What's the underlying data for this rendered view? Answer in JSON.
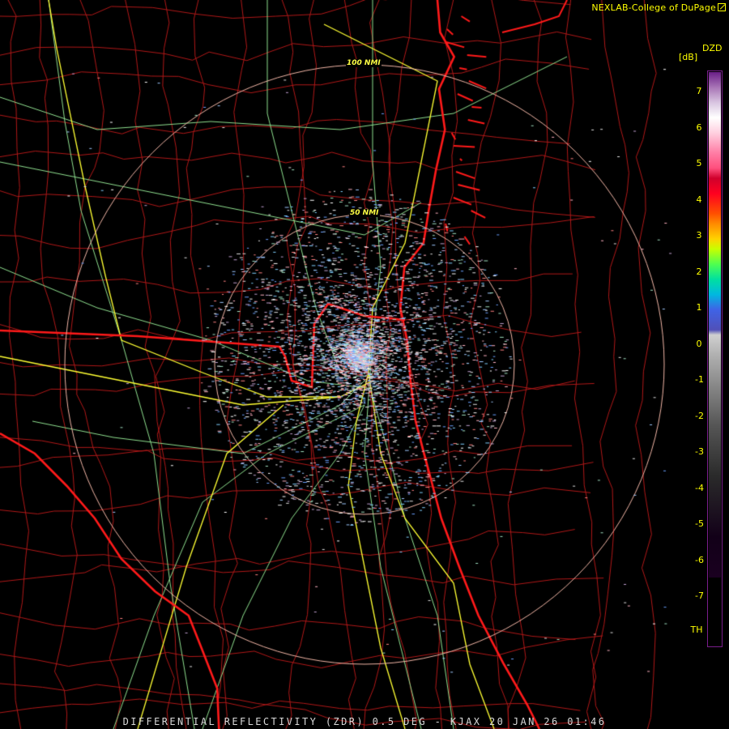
{
  "credit": "NEXLAB-College of DuPage",
  "credit_icon": "external-link-icon",
  "footer": "DIFFERENTIAL REFLECTIVITY (ZDR) 0.5 DEG - KJAX 20 JAN 26 01:46",
  "legend": {
    "title": "DZD",
    "unit": "[dB]",
    "labels": [
      "7",
      "6",
      "5",
      "4",
      "3",
      "2",
      "1",
      "0",
      "-1",
      "-2",
      "-3",
      "-4",
      "-5",
      "-6",
      "-7",
      "TH"
    ]
  },
  "range_rings": {
    "inner": "50 NMI",
    "outer": "100 NMI"
  },
  "colors": {
    "coast_state": "#ff1a1a",
    "county": "#b01818",
    "highway_interstate": "#ffff33",
    "highway_minor": "#8fe08f",
    "ring": "#f2b6a6",
    "text": "#ffff00"
  }
}
